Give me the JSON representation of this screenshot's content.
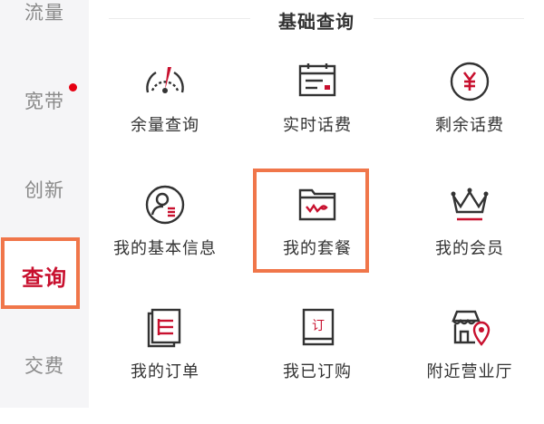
{
  "sidebar": {
    "items": [
      {
        "label": "流量",
        "has_dot": false,
        "active": false
      },
      {
        "label": "宽带",
        "has_dot": true,
        "active": false
      },
      {
        "label": "创新",
        "has_dot": false,
        "active": false
      },
      {
        "label": "查询",
        "has_dot": false,
        "active": true
      },
      {
        "label": "交费",
        "has_dot": false,
        "active": false
      }
    ]
  },
  "section": {
    "title": "基础查询"
  },
  "grid": {
    "items": [
      {
        "label": "余量查询",
        "icon": "gauge-icon"
      },
      {
        "label": "实时话费",
        "icon": "bill-icon"
      },
      {
        "label": "剩余话费",
        "icon": "yuan-coin-icon"
      },
      {
        "label": "我的基本信息",
        "icon": "user-profile-icon"
      },
      {
        "label": "我的套餐",
        "icon": "folder-package-icon"
      },
      {
        "label": "我的会员",
        "icon": "crown-icon"
      },
      {
        "label": "我的订单",
        "icon": "order-list-icon"
      },
      {
        "label": "我已订购",
        "icon": "subscription-book-icon"
      },
      {
        "label": "附近营业厅",
        "icon": "store-location-icon"
      }
    ]
  },
  "colors": {
    "accent": "#c8102e",
    "highlight_border": "#f0764a",
    "badge": "#e60012",
    "icon_stroke": "#333333"
  }
}
